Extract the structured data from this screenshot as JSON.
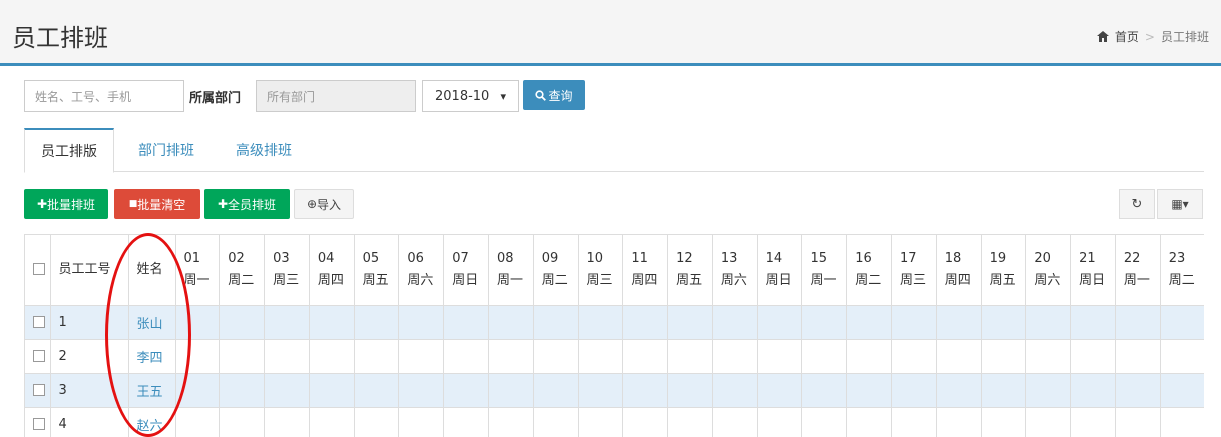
{
  "header": {
    "title": "员工排班",
    "breadcrumb": {
      "home_icon": "home-icon",
      "home": "首页",
      "separator": ">",
      "current": "员工排班"
    }
  },
  "filters": {
    "search_placeholder": "姓名、工号、手机",
    "dept_label": "所属部门",
    "dept_placeholder": "所有部门",
    "month_value": "2018-10",
    "month_arrow": "▾",
    "query_label": "查询",
    "query_icon": "search-icon"
  },
  "tabs": [
    {
      "label": "员工排版",
      "active": true
    },
    {
      "label": "部门排班",
      "active": false
    },
    {
      "label": "高级排班",
      "active": false
    }
  ],
  "toolbar": {
    "batch_schedule": "批量排班",
    "batch_clear": "批量清空",
    "all_schedule": "全员排班",
    "import": "导入",
    "plus_glyph": "✚",
    "clear_glyph": "■",
    "import_glyph": "⊕",
    "refresh_icon": "refresh-icon",
    "refresh_glyph": "↻",
    "columns_icon": "columns-icon",
    "columns_glyph": "▦▾"
  },
  "table": {
    "col_id": "员工工号",
    "col_name": "姓名",
    "days": [
      {
        "d": "01",
        "w": "周一"
      },
      {
        "d": "02",
        "w": "周二"
      },
      {
        "d": "03",
        "w": "周三"
      },
      {
        "d": "04",
        "w": "周四"
      },
      {
        "d": "05",
        "w": "周五"
      },
      {
        "d": "06",
        "w": "周六"
      },
      {
        "d": "07",
        "w": "周日"
      },
      {
        "d": "08",
        "w": "周一"
      },
      {
        "d": "09",
        "w": "周二"
      },
      {
        "d": "10",
        "w": "周三"
      },
      {
        "d": "11",
        "w": "周四"
      },
      {
        "d": "12",
        "w": "周五"
      },
      {
        "d": "13",
        "w": "周六"
      },
      {
        "d": "14",
        "w": "周日"
      },
      {
        "d": "15",
        "w": "周一"
      },
      {
        "d": "16",
        "w": "周二"
      },
      {
        "d": "17",
        "w": "周三"
      },
      {
        "d": "18",
        "w": "周四"
      },
      {
        "d": "19",
        "w": "周五"
      },
      {
        "d": "20",
        "w": "周六"
      },
      {
        "d": "21",
        "w": "周日"
      },
      {
        "d": "22",
        "w": "周一"
      },
      {
        "d": "23",
        "w": "周二"
      }
    ],
    "rows": [
      {
        "id": "1",
        "name": "张山"
      },
      {
        "id": "2",
        "name": "李四"
      },
      {
        "id": "3",
        "name": "王五"
      },
      {
        "id": "4",
        "name": "赵六"
      }
    ]
  },
  "colors": {
    "accent": "#3c8dbc",
    "success": "#00a65a",
    "danger": "#dd4b39",
    "annotation": "#e41111",
    "stripe": "#e4eff9"
  }
}
